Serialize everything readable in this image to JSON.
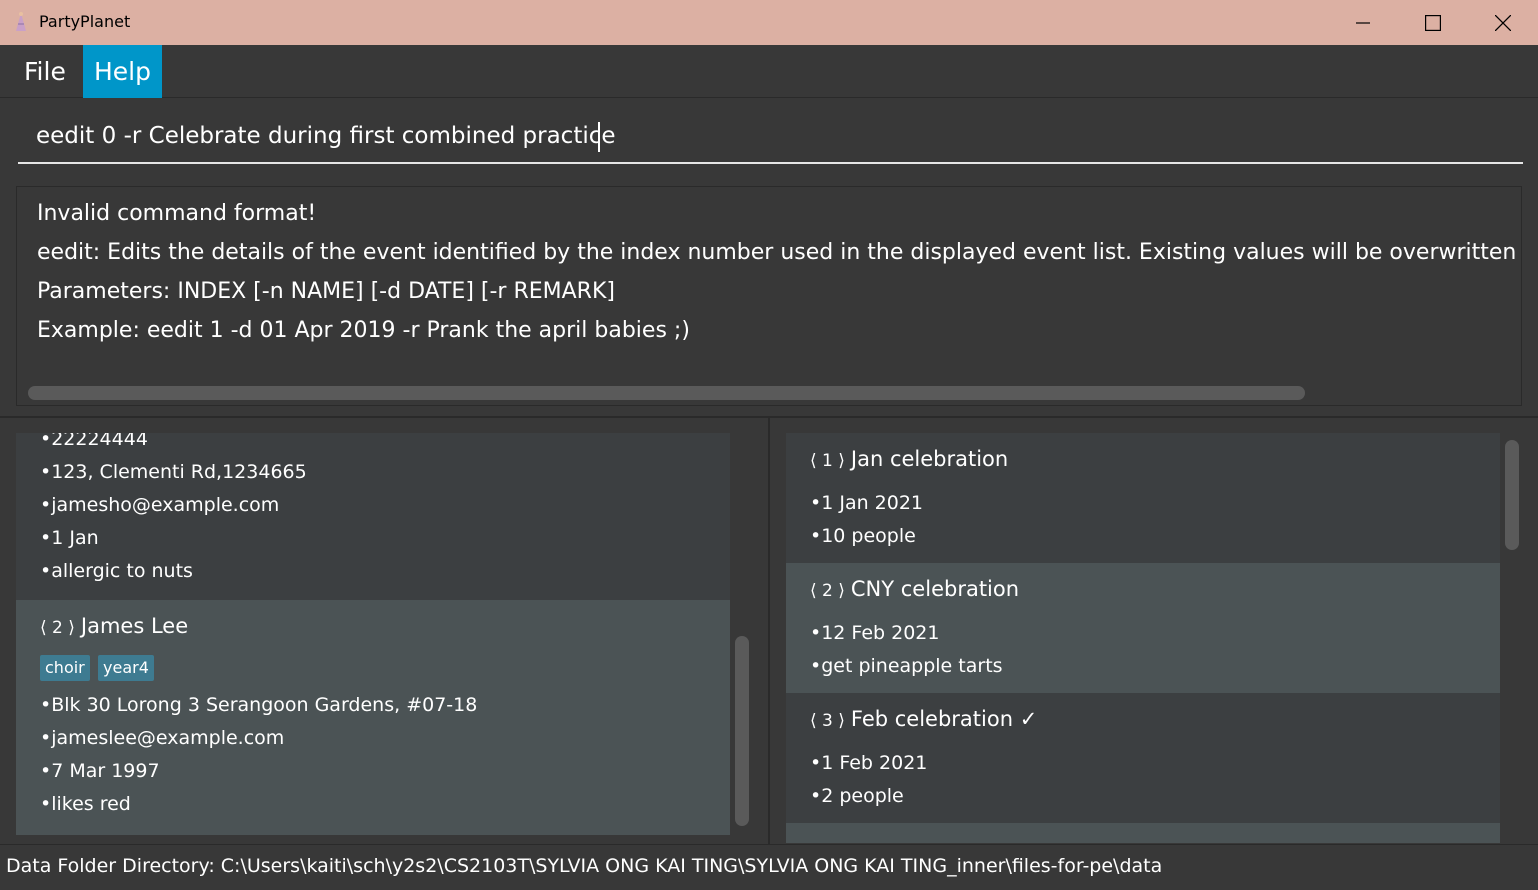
{
  "window": {
    "title": "PartyPlanet",
    "icon": "party-icon",
    "controls": [
      "minimize-icon",
      "maximize-icon",
      "close-icon"
    ]
  },
  "menu": {
    "file": "File",
    "help": "Help"
  },
  "command": {
    "value": "eedit 0 -r Celebrate during first combined practice"
  },
  "result": {
    "lines": [
      "Invalid command format!",
      "eedit: Edits the details of the event identified by the index number used in the displayed event list. Existing values will be overwritten",
      "Parameters: INDEX [-n NAME] [-d DATE] [-r REMARK]",
      "Example: eedit 1 -d 01 Apr 2019 -r Prank the april babies ;)"
    ]
  },
  "persons": [
    {
      "fields": [
        "•22224444",
        "•123, Clementi Rd,1234665",
        "•jamesho@example.com",
        "•1 Jan",
        "•allergic to nuts"
      ]
    },
    {
      "index": "⟨ 2 ⟩",
      "name": "James Lee",
      "tags": [
        "choir",
        "year4"
      ],
      "fields": [
        "•Blk 30 Lorong 3 Serangoon Gardens, #07-18",
        "•jameslee@example.com",
        "•7 Mar 1997",
        "•likes red"
      ]
    }
  ],
  "events": [
    {
      "index": "⟨ 1 ⟩",
      "name": "Jan celebration",
      "fields": [
        "•1 Jan 2021",
        "•10 people"
      ]
    },
    {
      "index": "⟨ 2 ⟩",
      "name": "CNY celebration",
      "fields": [
        "•12 Feb 2021",
        "•get pineapple tarts"
      ]
    },
    {
      "index": "⟨ 3 ⟩",
      "name": "Feb celebration ✓",
      "fields": [
        "•1 Feb 2021",
        "•2 people"
      ]
    }
  ],
  "status": {
    "path": "Data Folder Directory: C:\\Users\\kaiti\\sch\\y2s2\\CS2103T\\SYLVIA ONG KAI TING\\SYLVIA ONG KAI TING_inner\\files-for-pe\\data"
  },
  "colors": {
    "titlebar": "#dcb0a3",
    "accent": "#0096c9",
    "tag": "#3e7b91",
    "selected_card": "#4b5355",
    "background": "#383838"
  }
}
